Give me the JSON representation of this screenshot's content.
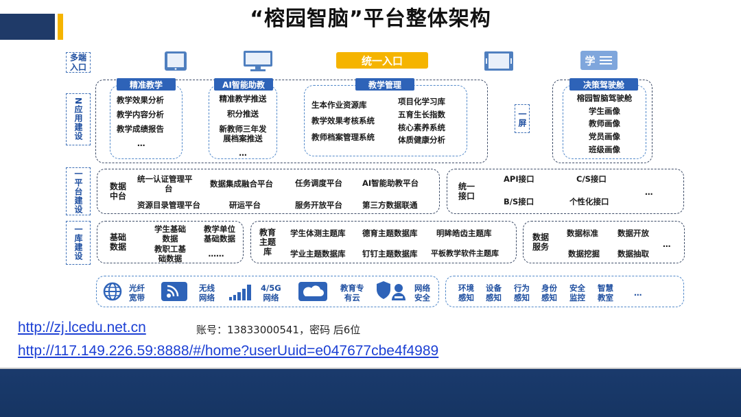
{
  "title": "“榕园智脑”平台整体架构",
  "rows": {
    "multi_entry": "多端\n入口",
    "n_apps": "N应用建设",
    "platform": "一平台建设",
    "library": "一库建设"
  },
  "entry_label": "统一入口",
  "student_icon_text": "学",
  "apps": {
    "jingzhun": {
      "title": "精准教学",
      "items": [
        "教学效果分析",
        "教学内容分析",
        "教学成绩报告",
        "…"
      ]
    },
    "ai": {
      "title": "AI智能助教",
      "items": [
        "精准教学推送",
        "积分推送",
        "新教师三年发",
        "展档案推送",
        "…"
      ]
    },
    "manage": {
      "title": "教学管理",
      "left": [
        "生本作业资源库",
        "教学效果考核系统",
        "教师档案管理系统"
      ],
      "right": [
        "项目化学习库",
        "五育生长指数",
        "核心素养系统",
        "体质健康分析"
      ]
    },
    "screen": "一屏",
    "decision": {
      "title": "决策驾驶舱",
      "items": [
        "榕园智脑驾驶舱",
        "学生画像",
        "教师画像",
        "党员画像",
        "班级画像"
      ]
    }
  },
  "platform": {
    "data_center": "数据\n中台",
    "r1": [
      "统一认证管理平",
      "台",
      "数据集成融合平台",
      "任务调度平台",
      "AI智能助教平台"
    ],
    "r2": [
      "资源目录管理平台",
      "研运平台",
      "服务开放平台",
      "第三方数据联通"
    ],
    "interface": "统一\n接口",
    "ifaces": [
      "API接口",
      "C/S接口",
      "B/S接口",
      "个性化接口",
      "…"
    ]
  },
  "library": {
    "basic": "基础\n数据",
    "b1": [
      "学生基础",
      "数据",
      "教学单位",
      "基础数据"
    ],
    "b2": [
      "教职工基",
      "础数据",
      "……"
    ],
    "theme_lib": "教育\n主题\n库",
    "t1": [
      "学生体测主题库",
      "德育主题数据库",
      "明眸皓齿主题库"
    ],
    "t2": [
      "学业主题数据库",
      "钉钉主题数据库",
      "平板教学软件主题库"
    ],
    "service": "数据\n服务",
    "s1": [
      "数据标准",
      "数据开放"
    ],
    "s2": [
      "数据挖掘",
      "数据抽取"
    ],
    "more": "…"
  },
  "infra": {
    "left": [
      "光纤\n宽带",
      "无线\n网络",
      "4/5G\n网络",
      "教育专\n有云",
      "网络\n安全"
    ],
    "right": [
      "环境\n感知",
      "设备\n感知",
      "行为\n感知",
      "身份\n感知",
      "安全\n监控",
      "智慧\n教室",
      "…"
    ]
  },
  "links": {
    "url1": "http://zj.lcedu.net.cn",
    "account": "账号：13833000541，密码 后6位",
    "url2": "http://117.149.226.59:8888/#/home?userUuid=e047677cbe4f4989"
  },
  "colors": {
    "accent_blue": "#2e63b8",
    "entry_yellow": "#f5b400",
    "footer_navy": "#1a3a6c",
    "link_blue": "#1b3fd4"
  }
}
